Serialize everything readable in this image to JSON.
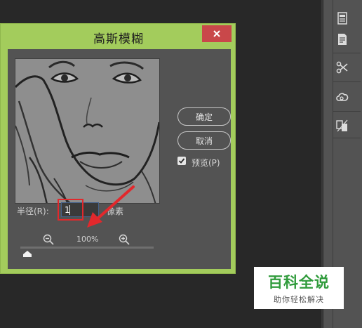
{
  "dialog": {
    "title": "高斯模糊",
    "ok_label": "确定",
    "cancel_label": "取消",
    "preview_label": "预览(P)",
    "preview_checked": true,
    "zoom": "100%",
    "radius_label": "半径(R):",
    "radius_value": "1",
    "unit": "像素",
    "slider_level_fraction": 0.02
  },
  "watermark": {
    "title": "百科全说",
    "subtitle": "助你轻松解决"
  },
  "colors": {
    "dialog_frame": "#a3cc5c",
    "close_button": "#c9484a",
    "annotation": "#e2282c",
    "watermark_green": "#2f9b3b"
  },
  "tool_panel": {
    "icons": [
      "properties-icon",
      "notes-icon",
      "scissors-icon",
      "creative-cloud-icon",
      "document-compare-icon"
    ]
  }
}
